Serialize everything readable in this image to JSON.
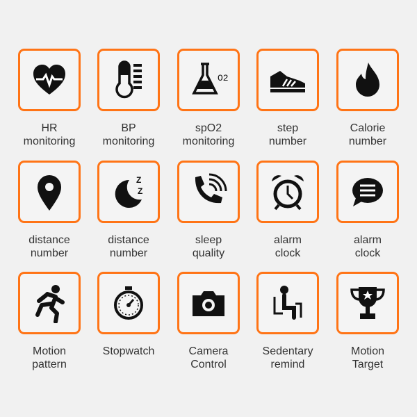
{
  "accent_color": "#ff7416",
  "features": [
    {
      "icon": "heart-rate-icon",
      "line1": "HR",
      "line2": "monitoring"
    },
    {
      "icon": "thermometer-icon",
      "line1": "BP",
      "line2": "monitoring"
    },
    {
      "icon": "flask-o2-icon",
      "line1": "spO2",
      "line2": "monitoring",
      "icon_text": "O2"
    },
    {
      "icon": "shoe-icon",
      "line1": "step",
      "line2": "number"
    },
    {
      "icon": "flame-icon",
      "line1": "Calorie",
      "line2": "number"
    },
    {
      "icon": "location-pin-icon",
      "line1": "distance",
      "line2": "number"
    },
    {
      "icon": "moon-sleep-icon",
      "line1": "distance",
      "line2": "number",
      "icon_text": "Z Z"
    },
    {
      "icon": "phone-call-icon",
      "line1": "sleep",
      "line2": "quality"
    },
    {
      "icon": "alarm-clock-icon",
      "line1": "alarm",
      "line2": "clock"
    },
    {
      "icon": "message-bubble-icon",
      "line1": "alarm",
      "line2": "clock"
    },
    {
      "icon": "running-icon",
      "line1": "Motion",
      "line2": "pattern"
    },
    {
      "icon": "stopwatch-icon",
      "line1": "Stopwatch",
      "line2": ""
    },
    {
      "icon": "camera-icon",
      "line1": "Camera",
      "line2": "Control"
    },
    {
      "icon": "sitting-person-icon",
      "line1": "Sedentary",
      "line2": "remind"
    },
    {
      "icon": "trophy-icon",
      "line1": "Motion",
      "line2": "Target"
    }
  ]
}
